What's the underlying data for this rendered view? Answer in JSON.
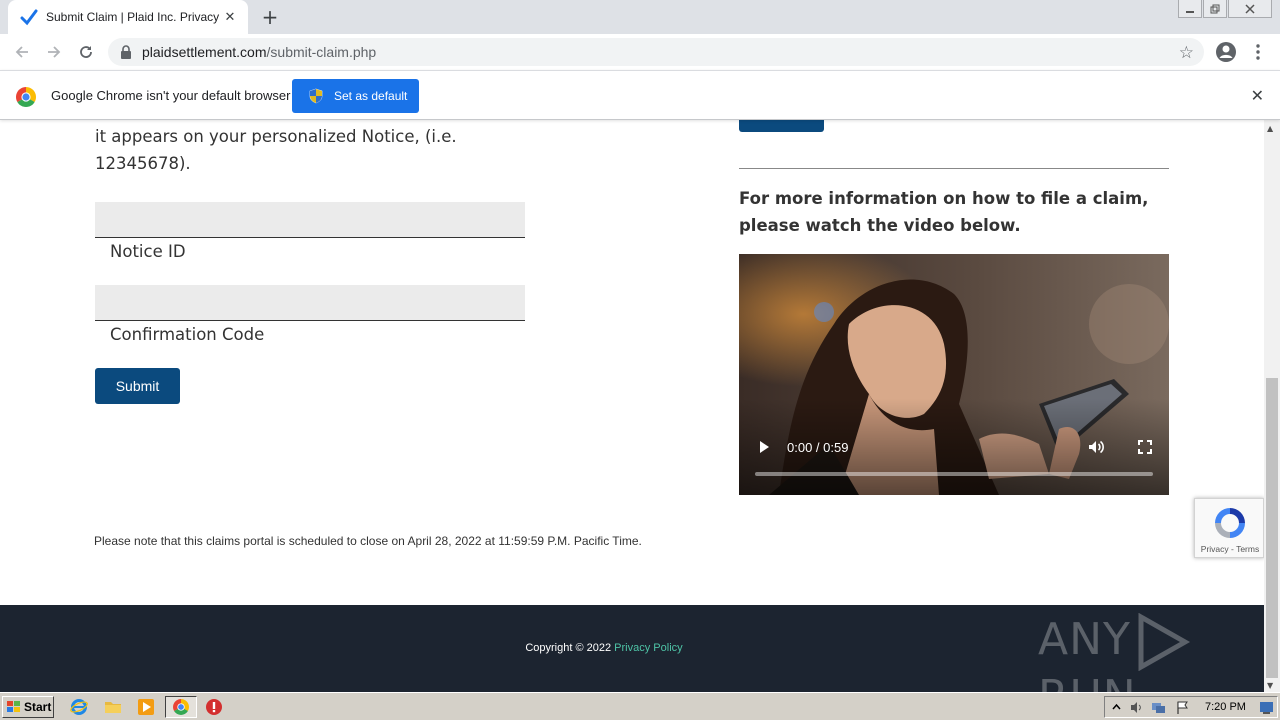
{
  "browser": {
    "tab_title": "Submit Claim | Plaid Inc. Privacy Litigation",
    "tab_close": "✕",
    "new_tab": "+",
    "url_host": "plaidsettlement.com",
    "url_path": "/submit-claim.php"
  },
  "infobar": {
    "message": "Google Chrome isn't your default browser",
    "set_default_label": "Set as default",
    "close": "✕"
  },
  "form": {
    "instructions": "it appears on your personalized Notice, (i.e. 12345678).",
    "notice_id_value": "",
    "notice_id_label": "Notice ID",
    "confirmation_code_value": "",
    "confirmation_code_label": "Confirmation Code",
    "submit_label": "Submit"
  },
  "info": {
    "heading": "For more information on how to file a claim, please watch the video below."
  },
  "video": {
    "time": "0:00 / 0:59",
    "progress": 0
  },
  "note": "Please note that this claims portal is scheduled to close on April 28, 2022 at 11:59:59 P.M. Pacific Time.",
  "footer": {
    "copyright": "Copyright © 2022",
    "privacy_link": "Privacy Policy",
    "watermark_left": "ANY",
    "watermark_right": "RUN"
  },
  "recaptcha": {
    "links": "Privacy - Terms"
  },
  "taskbar": {
    "start_label": "Start",
    "clock": "7:20 PM"
  },
  "colors": {
    "button_blue": "#0b4a7e",
    "chrome_blue": "#1a73e8",
    "footer_bg": "#1c2430",
    "link_green": "#4ec3a6"
  }
}
